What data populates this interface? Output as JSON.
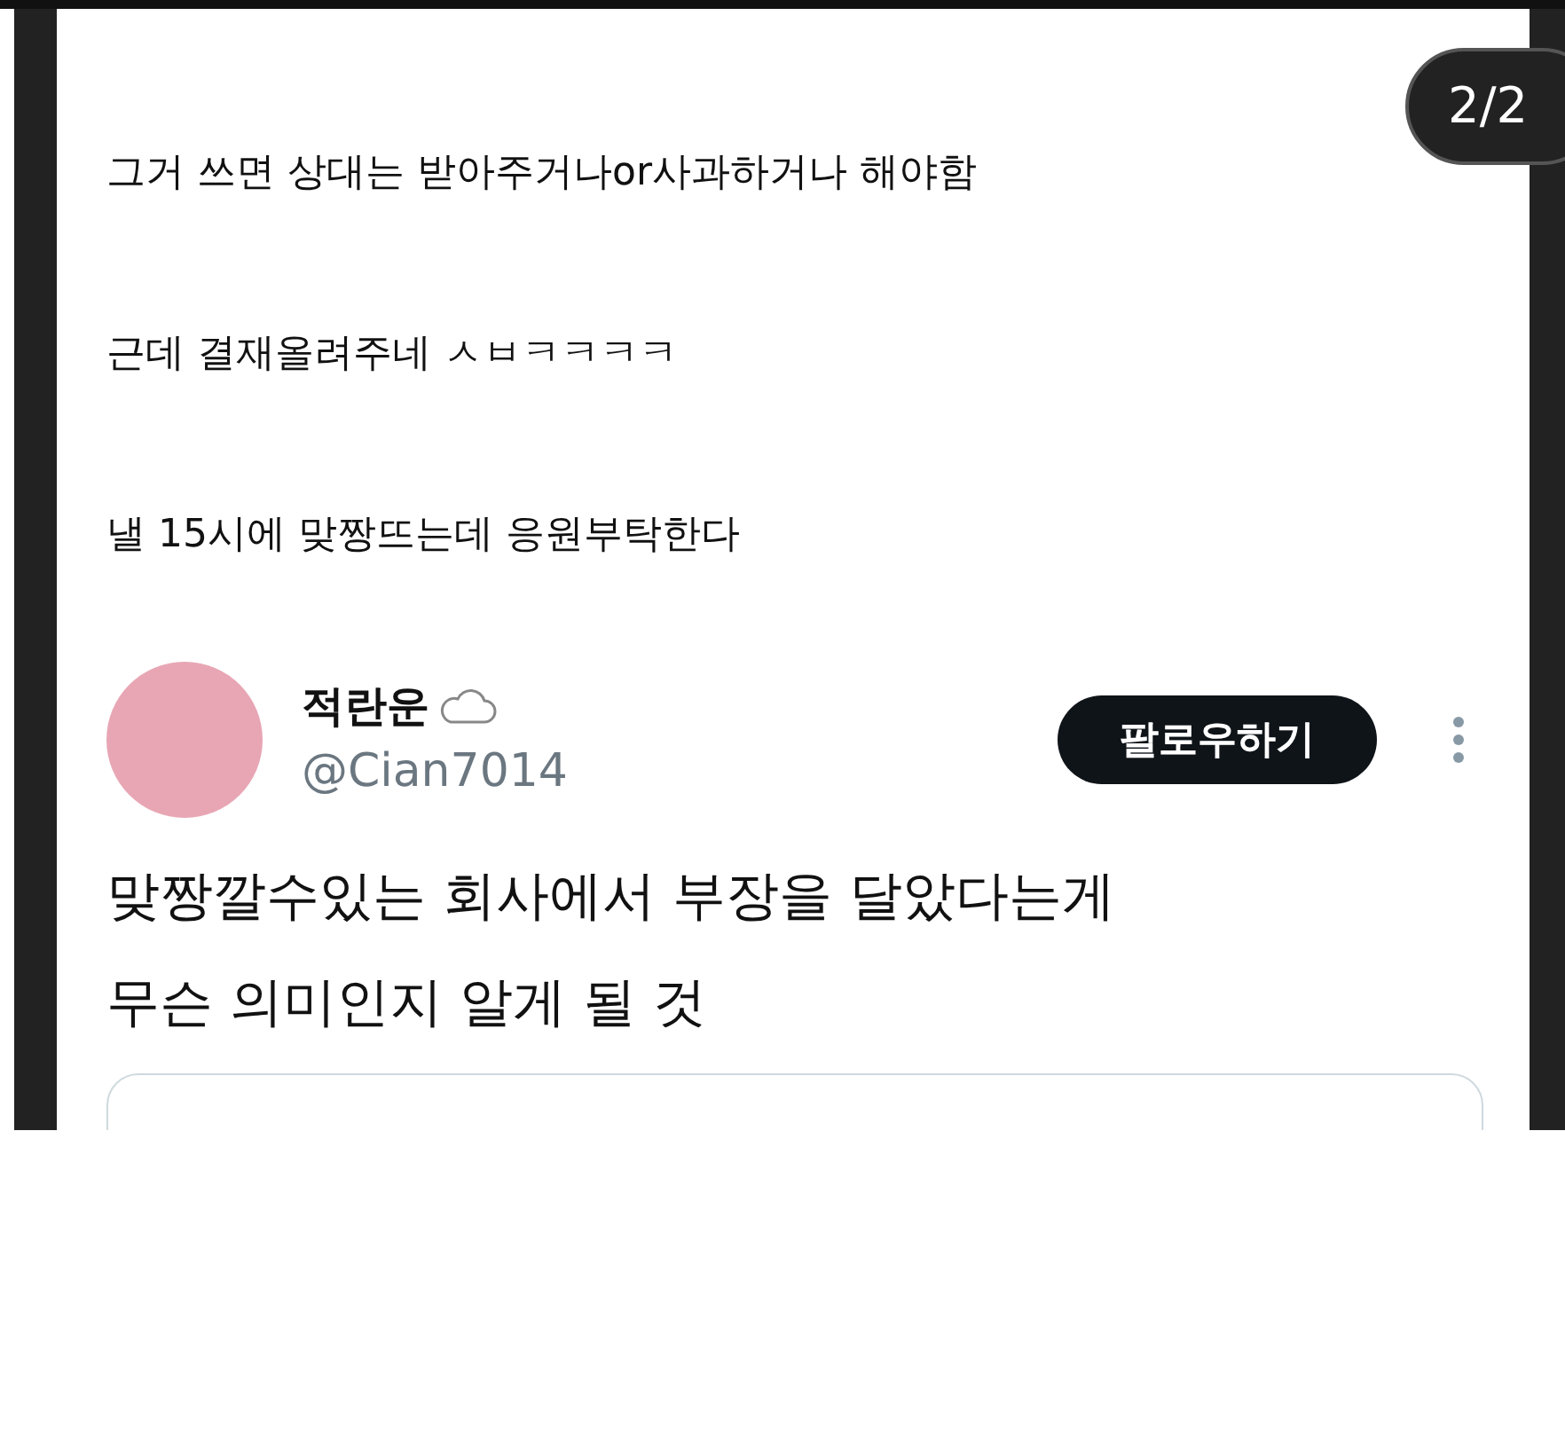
{
  "page_indicator": "2/2",
  "post_lines": [
    {
      "text": "그거 쓰면 상대는 받아주거나or사과하거나 해야함"
    },
    {
      "text": "근데 결재올려주네 ㅅㅂㅋㅋㅋㅋ"
    },
    {
      "text": "낼 15시에 맞짱뜨는데 응원부탁한다"
    }
  ],
  "quoted_tweet": {
    "display_name": "적란운",
    "handle": "@Cian7014",
    "follow_button": "팔로우하기",
    "lines": [
      {
        "text": "맞짱깔수있는 회사에서 부장을 달았다는게"
      },
      {
        "text": "무슨 의미인지 알게 될 것"
      }
    ]
  }
}
